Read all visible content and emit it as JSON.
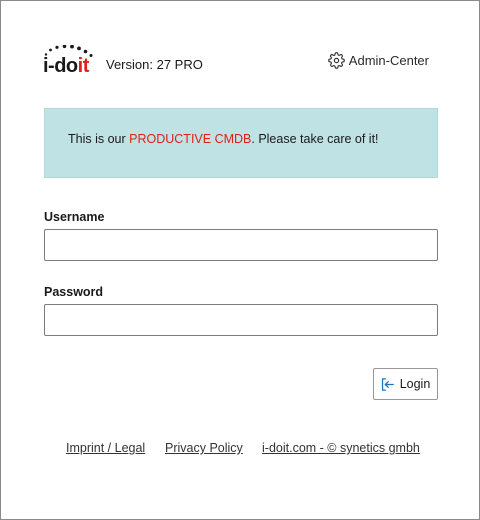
{
  "header": {
    "logo": {
      "text_main": "i-do",
      "text_accent": "it",
      "accent_color": "#e0201a",
      "icon": "idoit-logo"
    },
    "version_label": "Version: 27 PRO",
    "admin_center": {
      "label": "Admin-Center",
      "icon": "gear-icon"
    }
  },
  "notice": {
    "prefix": "This is our ",
    "highlight": "PRODUCTIVE CMDB",
    "suffix": ". Please take care of it!",
    "background_color": "#bfe2e4",
    "highlight_color": "#e0201a"
  },
  "form": {
    "username": {
      "label": "Username",
      "value": "",
      "placeholder": ""
    },
    "password": {
      "label": "Password",
      "value": "",
      "placeholder": ""
    },
    "login_button": {
      "label": "Login",
      "icon": "login-icon"
    }
  },
  "footer": {
    "links": [
      {
        "label": "Imprint / Legal"
      },
      {
        "label": "Privacy Policy"
      },
      {
        "label": "i-doit.com - © synetics gmbh"
      }
    ]
  }
}
